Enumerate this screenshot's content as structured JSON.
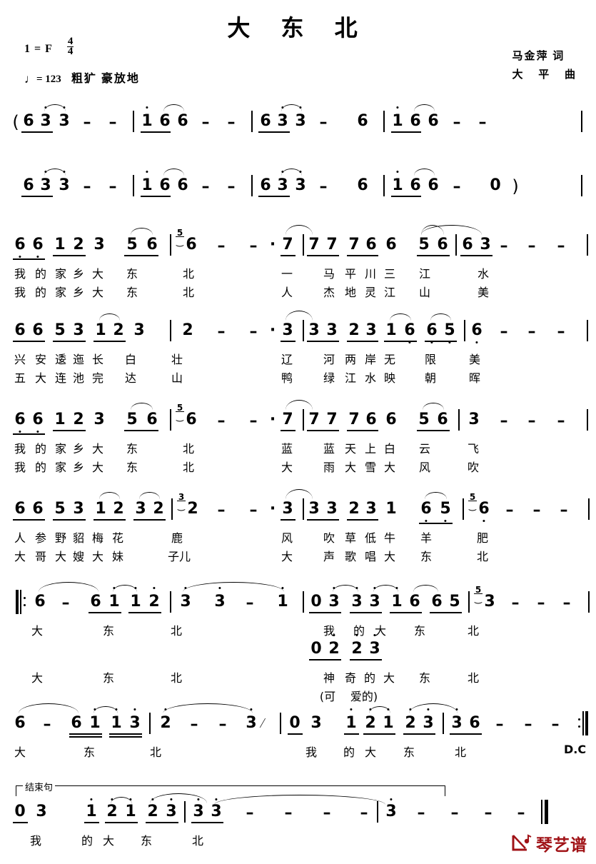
{
  "header": {
    "title": "大 东 北",
    "key": "1 = F",
    "meter_num": "4",
    "meter_den": "4",
    "tempo_note": "♩",
    "tempo_eq": "= 123",
    "expression": "粗犷 豪放地",
    "lyricist": "马金萍 词",
    "composer": "大 平 曲"
  },
  "intro": {
    "open_paren": "(",
    "close_paren": ")",
    "line1": "6 3 3 - - | 1 6 6 - - | 6 3 3 - 6 | 1 6 6 - - |",
    "line2": "6 3 3 - - | 1 6 6 - - | 6 3 3 - 6 | 1 6 6 - 0 ) |"
  },
  "systems": [
    {
      "name": "verse-line-1",
      "notes": "6 6 1 2 3  5 6 | (5)6 - - · 7 | 7 7 7 6 6  5 6 | 6 3 - - - |",
      "lyrics_a": [
        "我",
        "的",
        "家",
        "乡",
        "大",
        "东",
        "北",
        "一",
        "马",
        "平",
        "川",
        "三",
        "江",
        "水"
      ],
      "lyrics_b": [
        "我",
        "的",
        "家",
        "乡",
        "大",
        "东",
        "北",
        "人",
        "杰",
        "地",
        "灵",
        "江",
        "山",
        "美"
      ]
    },
    {
      "name": "verse-line-2",
      "notes": "6 6 5 3 1 2 3 | 2 - - · 3 | 3 3 2 3 1 6  6 5 | 6 - - - |",
      "lyrics_a": [
        "兴",
        "安",
        "逶",
        "迤",
        "长",
        "白",
        "壮",
        "辽",
        "河",
        "两",
        "岸",
        "无",
        "限",
        "美"
      ],
      "lyrics_b": [
        "五",
        "大",
        "连",
        "池",
        "完",
        "达",
        "山",
        "鸭",
        "绿",
        "江",
        "水",
        "映",
        "朝",
        "晖"
      ]
    },
    {
      "name": "verse-line-3",
      "notes": "6 6 1 2 3  5 6 | (5)6 - - · 7 | 7 7 7 6 6  5 6 | 3 - - - |",
      "lyrics_a": [
        "我",
        "的",
        "家",
        "乡",
        "大",
        "东",
        "北",
        "蓝",
        "蓝",
        "天",
        "上",
        "白",
        "云",
        "飞"
      ],
      "lyrics_b": [
        "我",
        "的",
        "家",
        "乡",
        "大",
        "东",
        "北",
        "大",
        "雨",
        "大",
        "雪",
        "大",
        "风",
        "吹"
      ]
    },
    {
      "name": "verse-line-4",
      "notes": "6 6 5 3 1 2 3 2 | (3)2 - - · 3 | 3 3 2 3 1  6 5 | (5)6 - - - |",
      "lyrics_a": [
        "人",
        "参",
        "野",
        "貂",
        "梅",
        "花",
        "鹿",
        "风",
        "吹",
        "草",
        "低",
        "牛",
        "羊",
        "肥"
      ],
      "lyrics_b": [
        "大",
        "哥",
        "大",
        "嫂",
        "大",
        "妹",
        "子儿",
        "大",
        "声",
        "歌",
        "唱",
        "大",
        "东",
        "北"
      ]
    },
    {
      "name": "chorus-line-1",
      "notes": "‖: 6 - 6 1 1 2 | 3 3 - 1 | 0 3 3 3 1 6 6 5 | (5)3 - - - |",
      "lyrics_a": [
        "大",
        "东",
        "北",
        "我",
        "的",
        "大",
        "东",
        "北"
      ],
      "alt_notes": "0 2  2 3",
      "lyrics_b": [
        "大",
        "东",
        "北",
        "神",
        "奇",
        "的",
        "大",
        "东",
        "北"
      ],
      "lyrics_b_extra": [
        "(可",
        "爱的)"
      ]
    },
    {
      "name": "chorus-line-2",
      "notes": "6 - 6 1 1 3 | 2 - - 3 | 0 3 1 2 1 2 3 | 3 6 - - - :‖",
      "lyrics_a": [
        "大",
        "东",
        "北",
        "我",
        "的",
        "大",
        "东",
        "北"
      ],
      "dc": "D.C"
    },
    {
      "name": "ending-line",
      "bracket_label": "结束句",
      "notes": "0 3 1 2 1 2 3 | 3 3 - - - - | 3 - - - - ‖",
      "lyrics_a": [
        "我",
        "的",
        "大",
        "东",
        "北"
      ]
    }
  ],
  "watermark": {
    "text": "琴艺谱",
    "color": "#a01216"
  }
}
